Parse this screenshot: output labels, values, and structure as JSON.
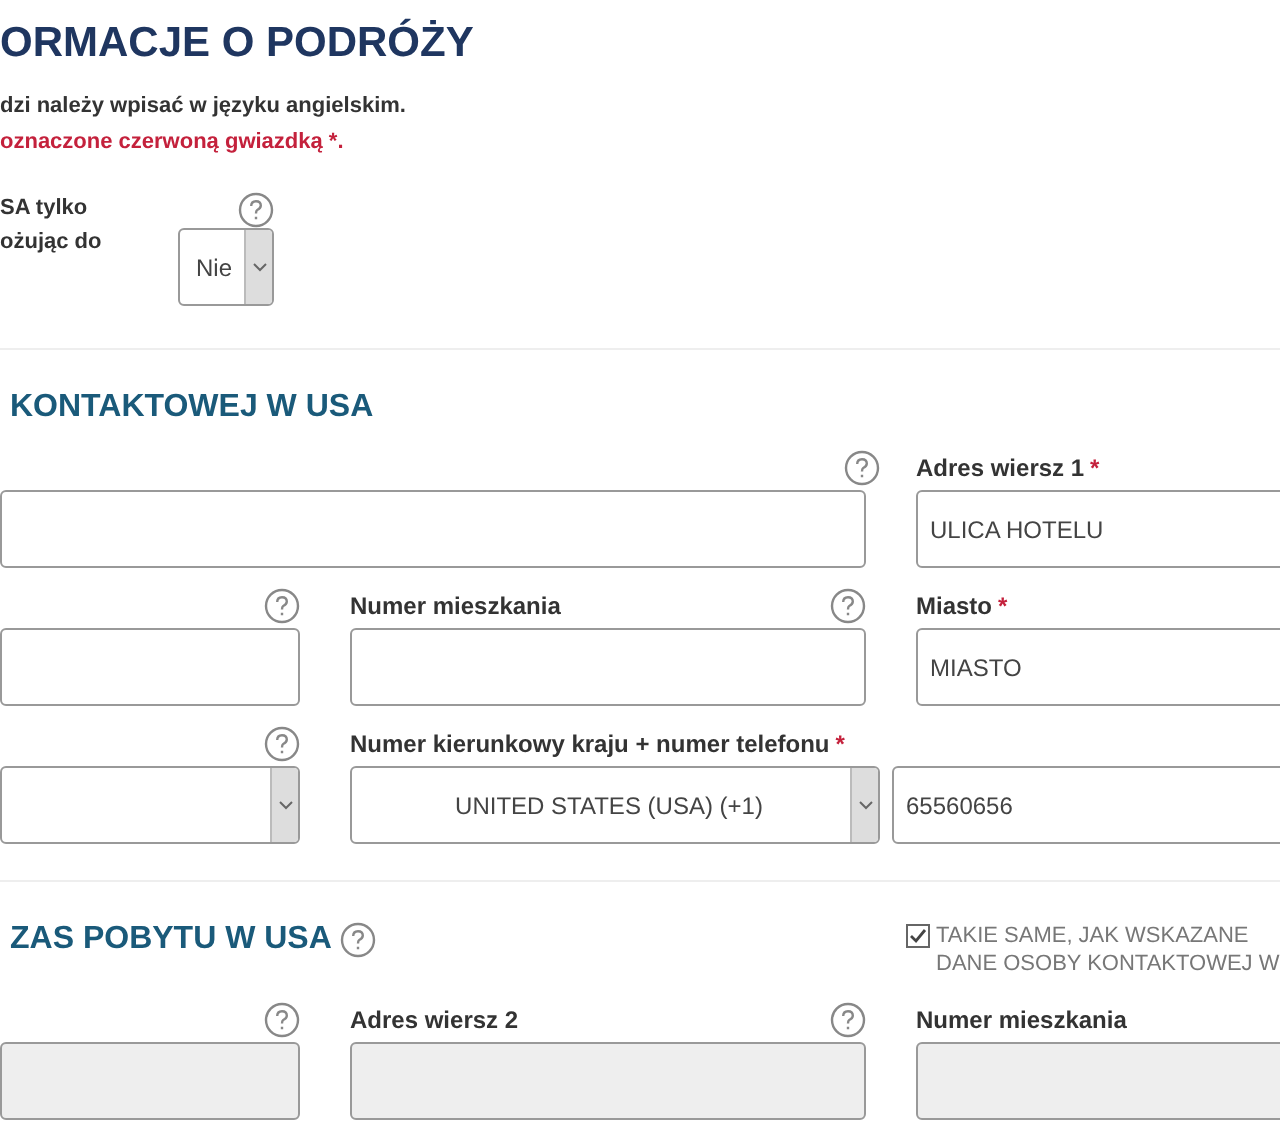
{
  "header": {
    "title": "ORMACJE O PODRÓŻY",
    "note": "dzi należy wpisać w języku angielskim.",
    "required_note": "oznaczone czerwoną gwiazdką *."
  },
  "question": {
    "lines": [
      "SA tylko",
      "ożując do"
    ],
    "help": true,
    "value": "Nie"
  },
  "sections": [
    {
      "title": "KONTAKTOWEJ W USA",
      "rows": [
        [
          {
            "kind": "input",
            "wide": true,
            "help": true,
            "disabled": false
          },
          {
            "kind": "input",
            "wide": false,
            "label": "Adres wiersz 1",
            "mark": "*",
            "help": false,
            "value": "ULICA HOTELU",
            "disabled": false
          }
        ],
        [
          {
            "kind": "input",
            "wide": false,
            "help": true,
            "disabled": false
          },
          {
            "kind": "input",
            "wide": false,
            "label": "Numer mieszkania",
            "help": true,
            "disabled": false
          },
          {
            "kind": "input",
            "wide": false,
            "label": "Miasto",
            "mark": "*",
            "help": false,
            "value": "MIASTO",
            "disabled": false
          }
        ],
        [
          {
            "kind": "select",
            "wide": false,
            "help": true,
            "disabled": false
          },
          {
            "kind": "phone",
            "wide": true,
            "label": "Numer kierunkowy kraju + numer telefonu",
            "mark": "*",
            "help": false,
            "value": "UNITED STATES (USA) (+1)",
            "number": "65560656",
            "disabled": false
          }
        ]
      ]
    },
    {
      "title": "ZAS POBYTU W USA",
      "help": true,
      "same_as": {
        "checked": true,
        "lines": [
          "TAKIE SAME, JAK WSKAZANE",
          "DANE OSOBY KONTAKTOWEJ W"
        ]
      },
      "rows": [
        [
          {
            "kind": "input",
            "wide": false,
            "help": true,
            "disabled": true
          },
          {
            "kind": "input",
            "wide": false,
            "label": "Adres wiersz 2",
            "help": true,
            "disabled": true
          },
          {
            "kind": "input",
            "wide": false,
            "label": "Numer mieszkania",
            "help": false,
            "disabled": true
          }
        ]
      ]
    }
  ]
}
